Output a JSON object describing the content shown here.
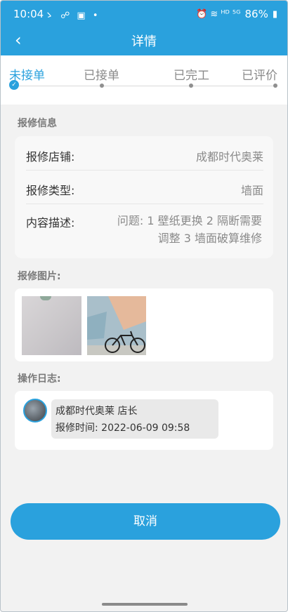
{
  "status_bar": {
    "time": "10:04",
    "left_icons": "ゝ ☍ ▣ •",
    "right_icons": "⏰ ≋ ᴴᴰ ⁵ᴳ",
    "battery": "86%"
  },
  "header": {
    "back_icon": "chevron-left-icon",
    "title": "详情"
  },
  "steps": [
    {
      "label": "未接单",
      "active": true
    },
    {
      "label": "已接单",
      "active": false
    },
    {
      "label": "已完工",
      "active": false
    },
    {
      "label": "已评价",
      "active": false
    }
  ],
  "repair_info": {
    "section_title": "报修信息",
    "shop_label": "报修店铺:",
    "shop_value": "成都时代奥莱",
    "type_label": "报修类型:",
    "type_value": "墙面",
    "desc_label": "内容描述:",
    "desc_value": "问题: 1 壁纸更换 2 隔断需要调整 3 墙面破算维修"
  },
  "images": {
    "section_title": "报修图片:"
  },
  "log": {
    "section_title": "操作日志:",
    "entry_name": "成都时代奥莱 店长",
    "entry_time": "报修时间: 2022-06-09 09:58"
  },
  "actions": {
    "cancel_label": "取消"
  },
  "colors": {
    "accent": "#2aa1dd",
    "background": "#f2f2f2"
  }
}
